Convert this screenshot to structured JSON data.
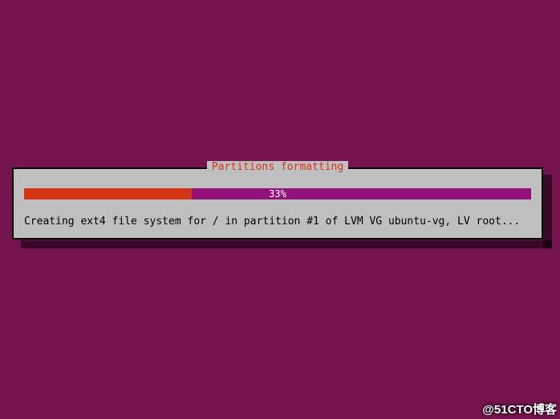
{
  "dialog": {
    "title": "Partitions formatting",
    "progress": {
      "percent": 33,
      "label": "33%"
    },
    "status": "Creating ext4 file system for / in partition #1 of LVM VG ubuntu-vg, LV root..."
  },
  "watermark": "@51CTO博客",
  "colors": {
    "background": "#75134e",
    "bar_bg": "#92117a",
    "bar_fill": "#d43414",
    "panel": "#bfbfbf",
    "title": "#d9331b"
  }
}
